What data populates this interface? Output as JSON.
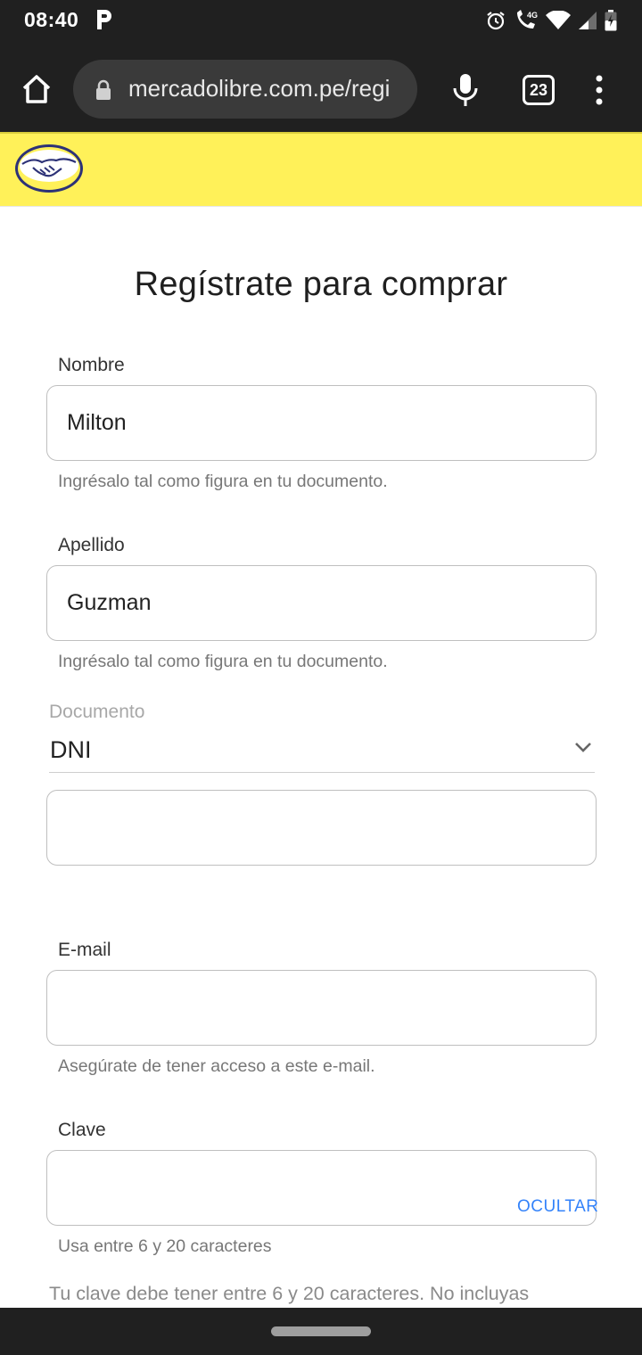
{
  "status_bar": {
    "time": "08:40",
    "network": "4G"
  },
  "browser": {
    "url": "mercadolibre.com.pe/regi",
    "tab_count": "23"
  },
  "header": {
    "brand_color": "#fff159"
  },
  "form": {
    "title": "Regístrate para comprar",
    "nombre": {
      "label": "Nombre",
      "value": "Milton",
      "helper": "Ingrésalo tal como figura en tu documento."
    },
    "apellido": {
      "label": "Apellido",
      "value": "Guzman",
      "helper": "Ingrésalo tal como figura en tu documento."
    },
    "documento": {
      "label": "Documento",
      "selected": "DNI",
      "number_value": ""
    },
    "email": {
      "label": "E-mail",
      "value": "",
      "helper": "Asegúrate de tener acceso a este e-mail."
    },
    "clave": {
      "label": "Clave",
      "value": "",
      "toggle_label": "OCULTAR",
      "helper": "Usa entre 6 y 20 caracteres"
    },
    "password_note": "Tu clave debe tener entre 6 y 20 caracteres. No incluyas"
  },
  "colors": {
    "link": "#3483fa",
    "chrome_dark": "#202020"
  }
}
